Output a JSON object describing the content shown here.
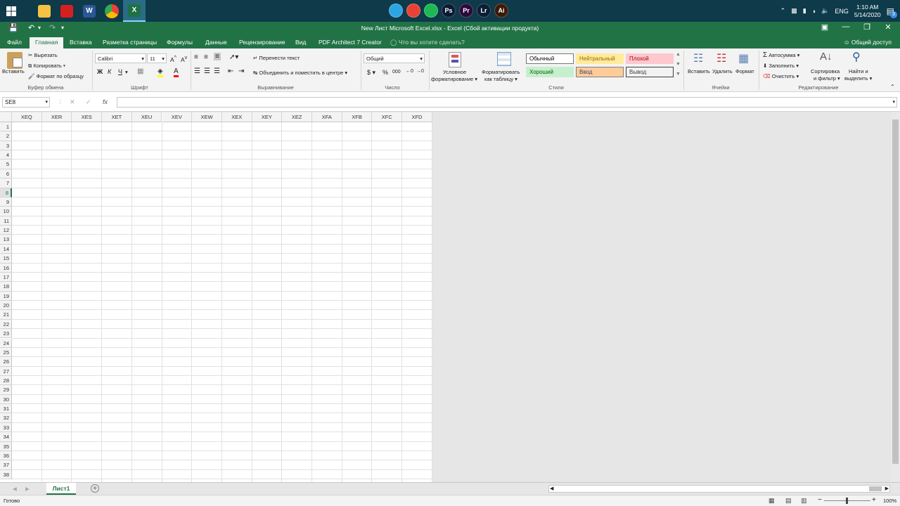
{
  "taskbar": {
    "pinned_left": [
      "windows-start",
      "file-explorer",
      "acrobat",
      "word",
      "chrome",
      "excel"
    ],
    "word_label": "W",
    "excel_label": "X",
    "center_apps": [
      {
        "name": "telegram",
        "label": "",
        "color": "#2ca5e0"
      },
      {
        "name": "chrome",
        "label": "",
        "color": "#e94235"
      },
      {
        "name": "spotify",
        "label": "",
        "color": "#1db954"
      },
      {
        "name": "photoshop",
        "label": "Ps",
        "color": "#0a1a34"
      },
      {
        "name": "premiere",
        "label": "Pr",
        "color": "#2a0a3c"
      },
      {
        "name": "lightroom",
        "label": "Lr",
        "color": "#0a1e34"
      },
      {
        "name": "illustrator",
        "label": "Ai",
        "color": "#3a1a08"
      }
    ],
    "language": "ENG",
    "time": "1:10 AM",
    "date": "5/14/2020",
    "notification_count": "3"
  },
  "titlebar": {
    "title": "New Лист Microsoft Excel.xlsx  -  Excel (Сбой активации продукта)"
  },
  "ribbon_tabs": {
    "file": "Файл",
    "home": "Главная",
    "insert": "Вставка",
    "page_layout": "Разметка страницы",
    "formulas": "Формулы",
    "data": "Данные",
    "review": "Рецензирование",
    "view": "Вид",
    "pdf": "PDF Architect 7 Creator",
    "tell_me": "Что вы хотите сделать?",
    "share": "Общий доступ"
  },
  "clipboard": {
    "paste": "Вставить",
    "cut": "Вырезать",
    "copy": "Копировать",
    "format_painter": "Формат по образцу",
    "group": "Буфер обмена"
  },
  "font": {
    "name": "Calibri",
    "size": "11",
    "bold": "Ж",
    "italic": "К",
    "underline": "Ч",
    "group": "Шрифт"
  },
  "alignment": {
    "wrap": "Перенести текст",
    "merge": "Объединить и поместить в центре",
    "group": "Выравнивание"
  },
  "number": {
    "format": "Общий",
    "currency": "$",
    "percent": "%",
    "thousands": "000",
    "group": "Число"
  },
  "styles": {
    "conditional": "Условное",
    "conditional2": "форматирование",
    "table": "Форматировать",
    "table2": "как таблицу",
    "cells": [
      {
        "label": "Обычный",
        "bg": "#ffffff",
        "fg": "#000000",
        "border": "#777777"
      },
      {
        "label": "Нейтральный",
        "bg": "#ffeb9c",
        "fg": "#9c6500",
        "border": "#ffeb9c"
      },
      {
        "label": "Плохой",
        "bg": "#ffc7ce",
        "fg": "#9c0006",
        "border": "#ffc7ce"
      },
      {
        "label": "Хороший",
        "bg": "#c6efce",
        "fg": "#006100",
        "border": "#c6efce"
      },
      {
        "label": "Ввод",
        "bg": "#ffcc99",
        "fg": "#3f3f76",
        "border": "#7f7f7f"
      },
      {
        "label": "Вывод",
        "bg": "#f2f2f2",
        "fg": "#3f3f3f",
        "border": "#3f3f3f"
      }
    ],
    "group": "Стили"
  },
  "cells_group": {
    "insert": "Вставить",
    "delete": "Удалить",
    "format": "Формат",
    "group": "Ячейки"
  },
  "editing": {
    "autosum": "Автосумма",
    "fill": "Заполнить",
    "clear": "Очистить",
    "sort": "Сортировка",
    "sort2": "и фильтр",
    "find": "Найти и",
    "find2": "выделить",
    "group": "Редактирование"
  },
  "formula_bar": {
    "name_box": "SE8",
    "fx": "fx",
    "value": ""
  },
  "grid": {
    "columns": [
      "XEQ",
      "XER",
      "XES",
      "XET",
      "XEU",
      "XEV",
      "XEW",
      "XEX",
      "XEY",
      "XEZ",
      "XFA",
      "XFB",
      "XFC",
      "XFD"
    ],
    "rows": [
      "1",
      "2",
      "3",
      "4",
      "5",
      "6",
      "7",
      "8",
      "9",
      "10",
      "11",
      "12",
      "13",
      "14",
      "15",
      "16",
      "17",
      "18",
      "19",
      "20",
      "21",
      "22",
      "23",
      "24",
      "25",
      "26",
      "27",
      "28",
      "29",
      "30",
      "31",
      "32",
      "33",
      "34",
      "35",
      "36",
      "37",
      "38"
    ],
    "selected_row": "8"
  },
  "sheets": {
    "active": "Лист1",
    "add": "+"
  },
  "status": {
    "ready": "Готово",
    "zoom": "100%"
  }
}
